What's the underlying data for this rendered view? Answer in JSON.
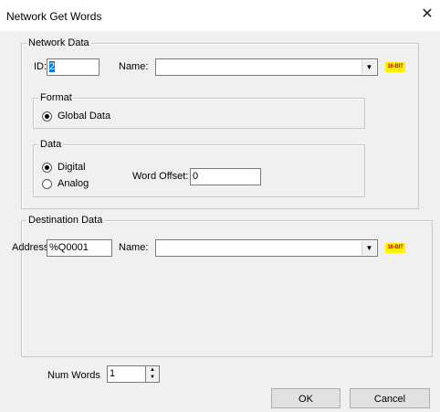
{
  "window": {
    "title": "Network Get Words"
  },
  "network_data": {
    "legend": "Network Data",
    "id_label": "ID:",
    "id_value": "2",
    "name_label": "Name:",
    "name_value": "",
    "badge": "16-BIT"
  },
  "format": {
    "legend": "Format",
    "global_data_label": "Global Data",
    "selected": "Global Data"
  },
  "data": {
    "legend": "Data",
    "digital_label": "Digital",
    "analog_label": "Analog",
    "selected": "Digital",
    "word_offset_label": "Word Offset:",
    "word_offset_value": "0"
  },
  "destination_data": {
    "legend": "Destination Data",
    "address_label": "Address:",
    "address_value": "%Q0001",
    "name_label": "Name:",
    "name_value": "",
    "badge": "16-BIT"
  },
  "num_words": {
    "label": "Num Words",
    "value": "1"
  },
  "buttons": {
    "ok": "OK",
    "cancel": "Cancel"
  },
  "colors": {
    "badge_bg": "#fff200",
    "badge_text": "#d0001a",
    "selection": "#0078d7"
  }
}
